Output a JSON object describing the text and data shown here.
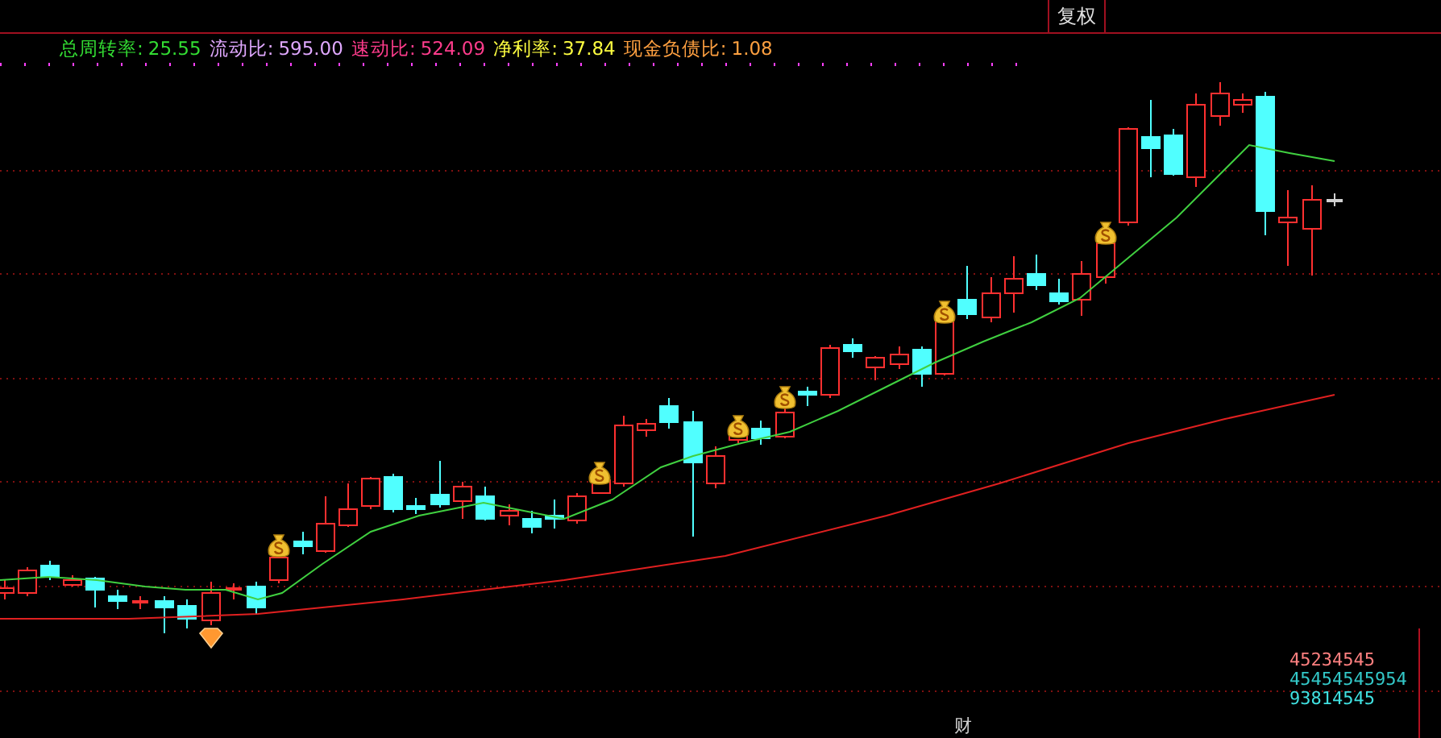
{
  "toolbar": {
    "tabs": [
      {
        "label": "复权"
      }
    ]
  },
  "indicators": [
    {
      "label": "总周转率:",
      "value": "25.55",
      "color": "#33dd33"
    },
    {
      "label": "流动比:",
      "value": "595.00",
      "color": "#e0a8ff"
    },
    {
      "label": "速动比:",
      "value": "524.09",
      "color": "#ff3c8c"
    },
    {
      "label": "净利率:",
      "value": "37.84",
      "color": "#ffff40"
    },
    {
      "label": "现金负债比:",
      "value": "1.08",
      "color": "#ffa040"
    }
  ],
  "legend": [
    {
      "text": "45234545",
      "color": "#ff8080"
    },
    {
      "text": "45454545954",
      "color": "#33c8c8"
    },
    {
      "text": "93814545",
      "color": "#40e0e0"
    }
  ],
  "bottom_marker": "财"
}
